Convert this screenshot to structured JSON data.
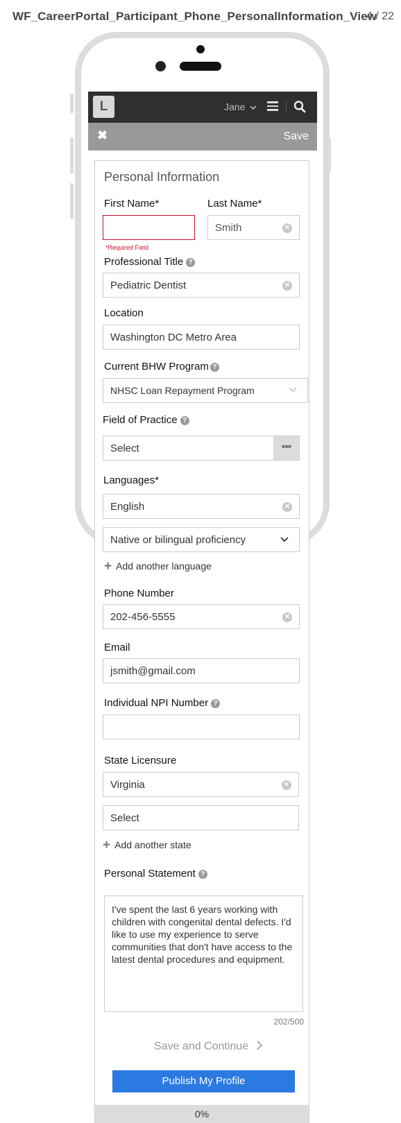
{
  "header": {
    "title": "WF_CareerPortal_Participant_Phone_PersonalInformation_View",
    "counter": "4 / 22"
  },
  "navbar": {
    "logo": "L",
    "user": "Jane",
    "icons": [
      "chevron-down-icon",
      "hamburger-menu-icon",
      "search-icon"
    ]
  },
  "actionbar": {
    "close_icon": "close-icon",
    "save_label": "Save"
  },
  "form": {
    "title": "Personal Information",
    "first_name": {
      "label": "First Name*",
      "value": "",
      "error": "*Required Field"
    },
    "last_name": {
      "label": "Last Name*",
      "value": "Smith"
    },
    "professional_title": {
      "label": "Professional Title",
      "value": "Pediatric Dentist"
    },
    "location": {
      "label": "Location",
      "value": "Washington DC Metro Area"
    },
    "bhw_program": {
      "label": "Current BHW Program",
      "value": "NHSC Loan Repayment Program"
    },
    "field_of_practice": {
      "label": "Field of Practice",
      "value": "Select"
    },
    "languages": {
      "label": "Languages*",
      "language": "English",
      "proficiency": "Native or bilingual proficiency",
      "add_label": "Add another language"
    },
    "phone": {
      "label": "Phone Number",
      "value": "202-456-5555"
    },
    "email": {
      "label": "Email",
      "value": "jsmith@gmail.com"
    },
    "npi": {
      "label": "Individual NPI Number",
      "value": ""
    },
    "state_licensure": {
      "label": "State Licensure",
      "state1": "Virginia",
      "state2": "Select",
      "add_label": "Add another state"
    },
    "personal_statement": {
      "label": "Personal Statement",
      "value": "I've spent the last 6 years working with children with congenital dental defects. I'd like to use my experience to serve communities that don't have access to the latest dental procedures and equipment.",
      "count": "202/500"
    },
    "save_continue": "Save and Continue",
    "publish": "Publish My Profile",
    "progress": "0%"
  },
  "colors": {
    "navbar": "#2f2f2f",
    "actionbar": "#999999",
    "primary": "#2a7ae2",
    "error": "#c8102e"
  }
}
